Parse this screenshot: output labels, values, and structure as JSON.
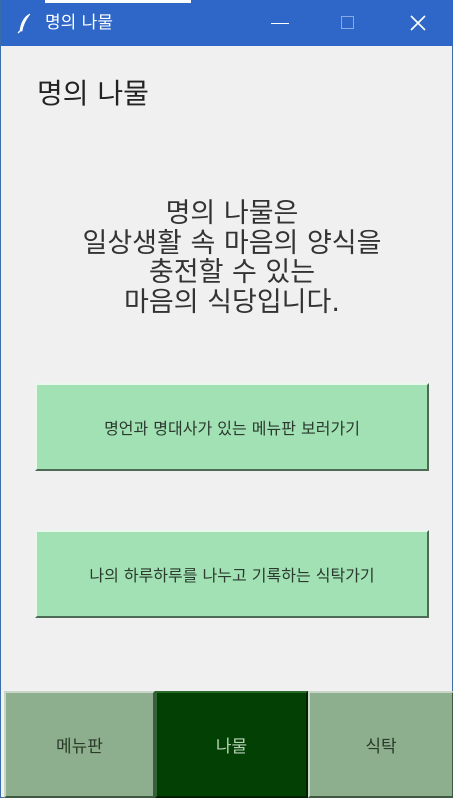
{
  "window": {
    "title": "명의 나물"
  },
  "titlebar": {
    "icons": {
      "app": "feather-icon",
      "minimize": "minimize-icon",
      "maximize": "maximize-icon",
      "close": "close-icon"
    },
    "colors": {
      "background": "#2f67c8"
    }
  },
  "page": {
    "heading": "명의 나물",
    "intro_lines": [
      "명의 나물은",
      "일상생활 속 마음의 양식을",
      "충전할 수 있는",
      "마음의 식당입니다."
    ]
  },
  "actions": {
    "menu_button": "명언과 명대사가 있는 메뉴판 보러가기",
    "table_button": "나의 하루하루를 나누고 기록하는 식탁가기",
    "color": "#a2e1b4"
  },
  "nav": {
    "tabs": [
      {
        "label": "메뉴판",
        "active": false
      },
      {
        "label": "나물",
        "active": true
      },
      {
        "label": "식탁",
        "active": false
      }
    ],
    "colors": {
      "inactive": "#8daf8d",
      "active": "#034003"
    }
  }
}
